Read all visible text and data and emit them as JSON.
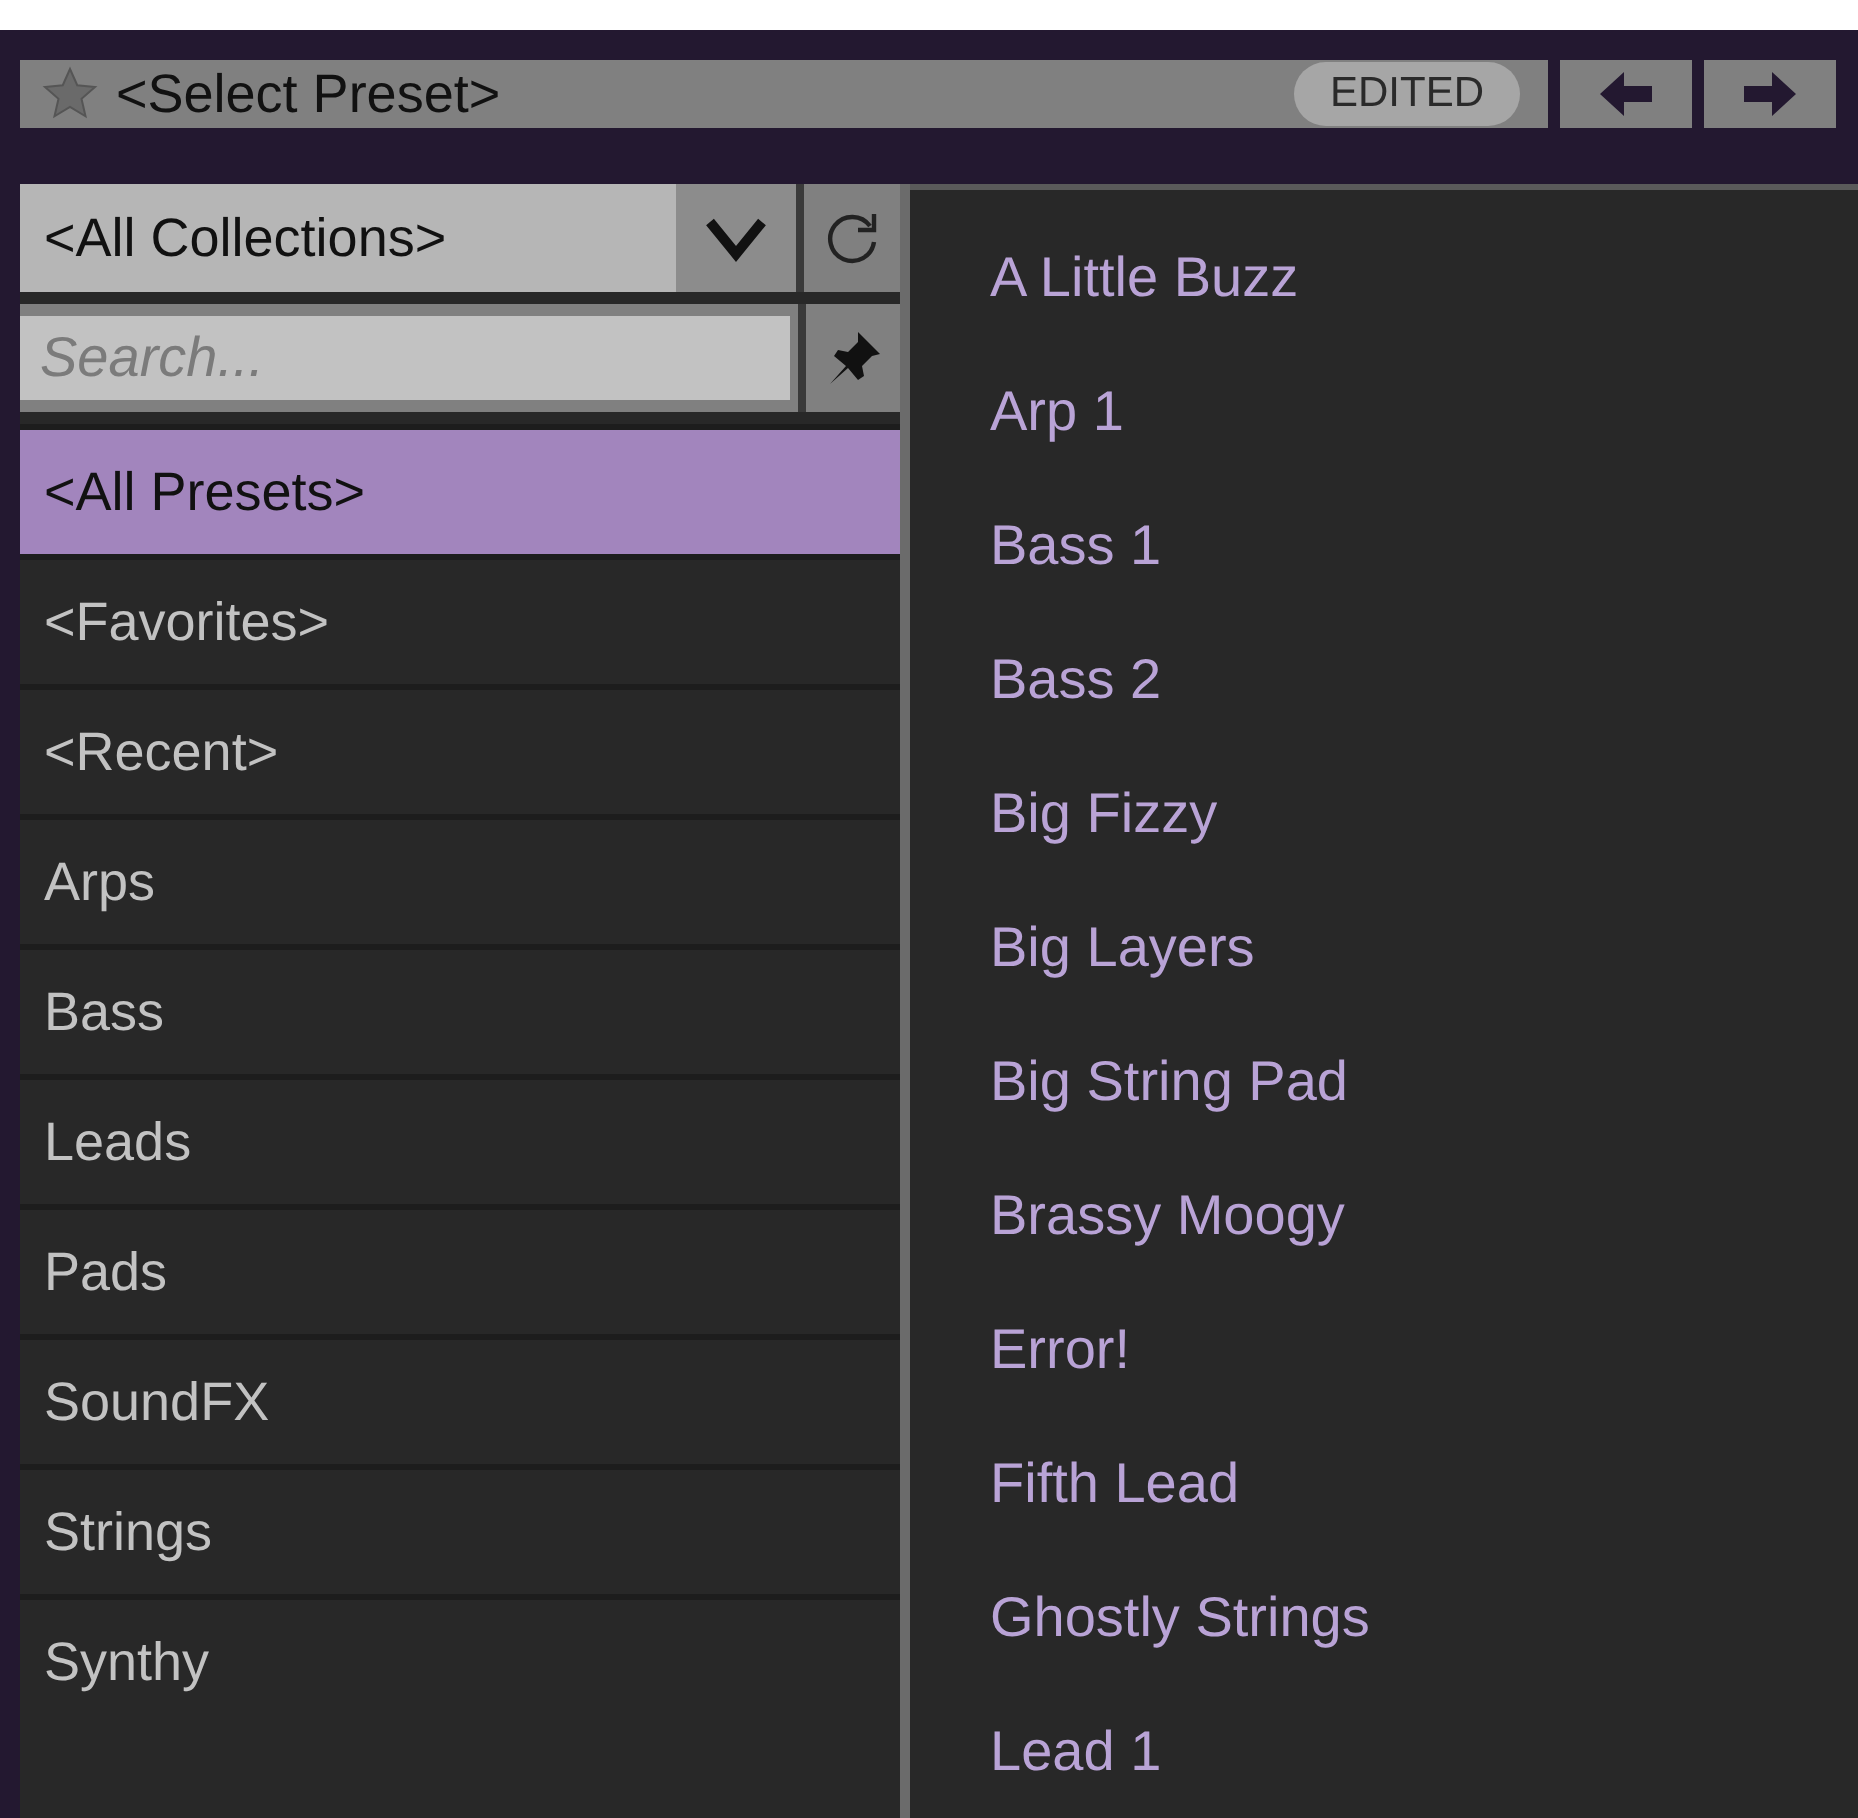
{
  "preset_bar": {
    "title": "<Select Preset>",
    "badge": "EDITED"
  },
  "collections": {
    "value": "<All Collections>"
  },
  "search": {
    "placeholder": "Search..."
  },
  "categories": [
    {
      "label": "<All Presets>",
      "selected": true
    },
    {
      "label": "<Favorites>",
      "selected": false
    },
    {
      "label": "<Recent>",
      "selected": false
    },
    {
      "label": "Arps",
      "selected": false
    },
    {
      "label": "Bass",
      "selected": false
    },
    {
      "label": "Leads",
      "selected": false
    },
    {
      "label": "Pads",
      "selected": false
    },
    {
      "label": "SoundFX",
      "selected": false
    },
    {
      "label": "Strings",
      "selected": false
    },
    {
      "label": "Synthy",
      "selected": false
    }
  ],
  "presets": [
    {
      "label": "A Little Buzz",
      "selected": false
    },
    {
      "label": "Arp 1",
      "selected": false
    },
    {
      "label": "Bass 1",
      "selected": false
    },
    {
      "label": "Bass 2",
      "selected": false
    },
    {
      "label": "Big Fizzy",
      "selected": false
    },
    {
      "label": "Big Layers",
      "selected": false
    },
    {
      "label": "Big String Pad",
      "selected": false
    },
    {
      "label": "Brassy Moogy",
      "selected": false
    },
    {
      "label": "Error!",
      "selected": false
    },
    {
      "label": "Fifth Lead",
      "selected": false
    },
    {
      "label": "Ghostly Strings",
      "selected": false
    },
    {
      "label": "Lead 1",
      "selected": false
    }
  ]
}
